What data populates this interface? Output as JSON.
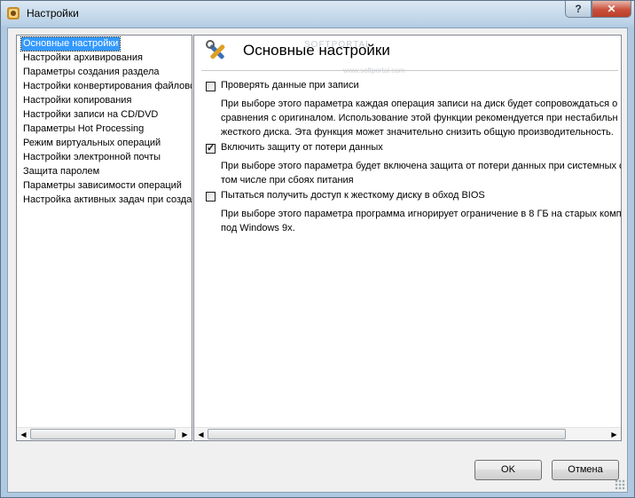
{
  "window": {
    "title": "Настройки",
    "help_label": "?",
    "close_label": "✕"
  },
  "nav": {
    "items": [
      "Основные настройки",
      "Настройки архивирования",
      "Параметры создания раздела",
      "Настройки конвертирования файловс",
      "Настройки копирования",
      "Настройки записи на CD/DVD",
      "Параметры Hot Processing",
      "Режим виртуальных операций",
      "Настройки электронной почты",
      "Защита паролем",
      "Параметры зависимости операций",
      "Настройка активных задач при созда"
    ],
    "selected_index": 0
  },
  "panel": {
    "title": "Основные настройки",
    "watermark": "SOFTPORTAL",
    "watermark_sub": "www.softportal.com",
    "options": [
      {
        "label": "Проверять данные при записи",
        "checked": false,
        "desc": [
          "При выборе этого параметра каждая операция записи на диск будет сопровождаться о",
          "сравнения с оригиналом. Использование этой функции рекомендуется при нестабильн",
          "жесткого диска. Эта функция может значительно снизить общую производительность."
        ]
      },
      {
        "label": "Включить защиту от потери данных",
        "checked": true,
        "desc": [
          "При выборе этого параметра будет включена защита от потери данных при системных с",
          "том числе при сбоях питания"
        ]
      },
      {
        "label": "Пытаться получить доступ к жесткому диску в обход BIOS",
        "checked": false,
        "desc": [
          "При выборе этого параметра программа игнорирует ограничение в 8 ГБ на старых комп",
          "под Windows 9x."
        ]
      }
    ]
  },
  "buttons": {
    "ok": "OK",
    "cancel": "Отмена"
  },
  "scroll": {
    "left_arrow": "◀",
    "right_arrow": "▶"
  }
}
